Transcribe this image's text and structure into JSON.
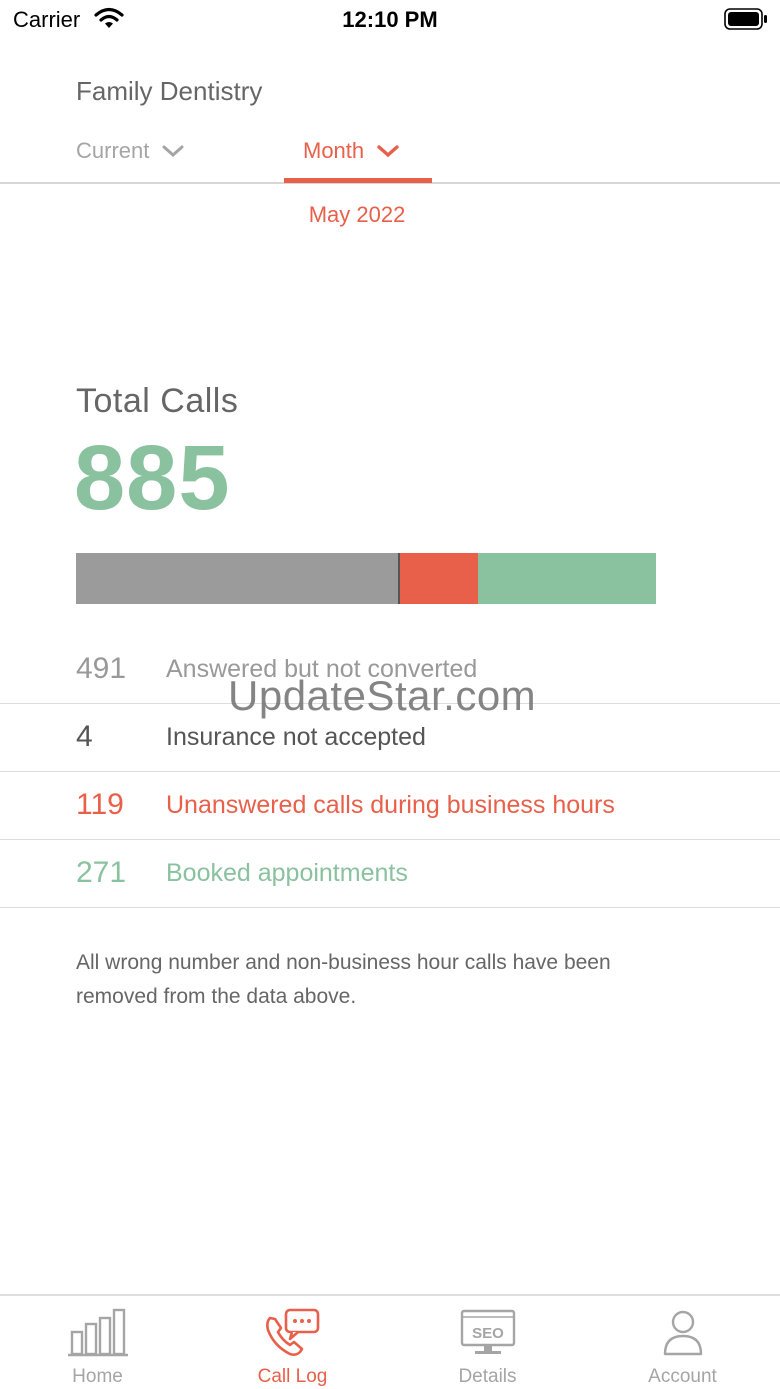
{
  "status_bar": {
    "carrier": "Carrier",
    "time": "12:10 PM"
  },
  "header": {
    "practice_name": "Family Dentistry"
  },
  "filters": {
    "current_label": "Current",
    "month_label": "Month",
    "period": "May 2022"
  },
  "summary": {
    "title": "Total Calls",
    "total": "885"
  },
  "colors": {
    "accent": "#e8604a",
    "green": "#8ac19e",
    "gray_bar": "#9b9b9b",
    "dark_text": "#555555",
    "light_text": "#999999"
  },
  "breakdown": [
    {
      "value": "491",
      "label": "Answered but not converted",
      "color": "#9b9b9b",
      "text_color": "#999999"
    },
    {
      "value": "4",
      "label": "Insurance not accepted",
      "color": "#555555",
      "text_color": "#555555"
    },
    {
      "value": "119",
      "label": "Unanswered calls during business hours",
      "color": "#e8604a",
      "text_color": "#e8604a"
    },
    {
      "value": "271",
      "label": "Booked appointments",
      "color": "#8ac19e",
      "text_color": "#8ac19e"
    }
  ],
  "footnote": "All wrong number and non-business hour calls have been removed from the data above.",
  "watermark": "UpdateStar.com",
  "tabs": [
    {
      "label": "Home",
      "icon": "bar-chart-icon",
      "active": false
    },
    {
      "label": "Call Log",
      "icon": "phone-chat-icon",
      "active": true
    },
    {
      "label": "Details",
      "icon": "seo-monitor-icon",
      "active": false
    },
    {
      "label": "Account",
      "icon": "user-icon",
      "active": false
    }
  ]
}
